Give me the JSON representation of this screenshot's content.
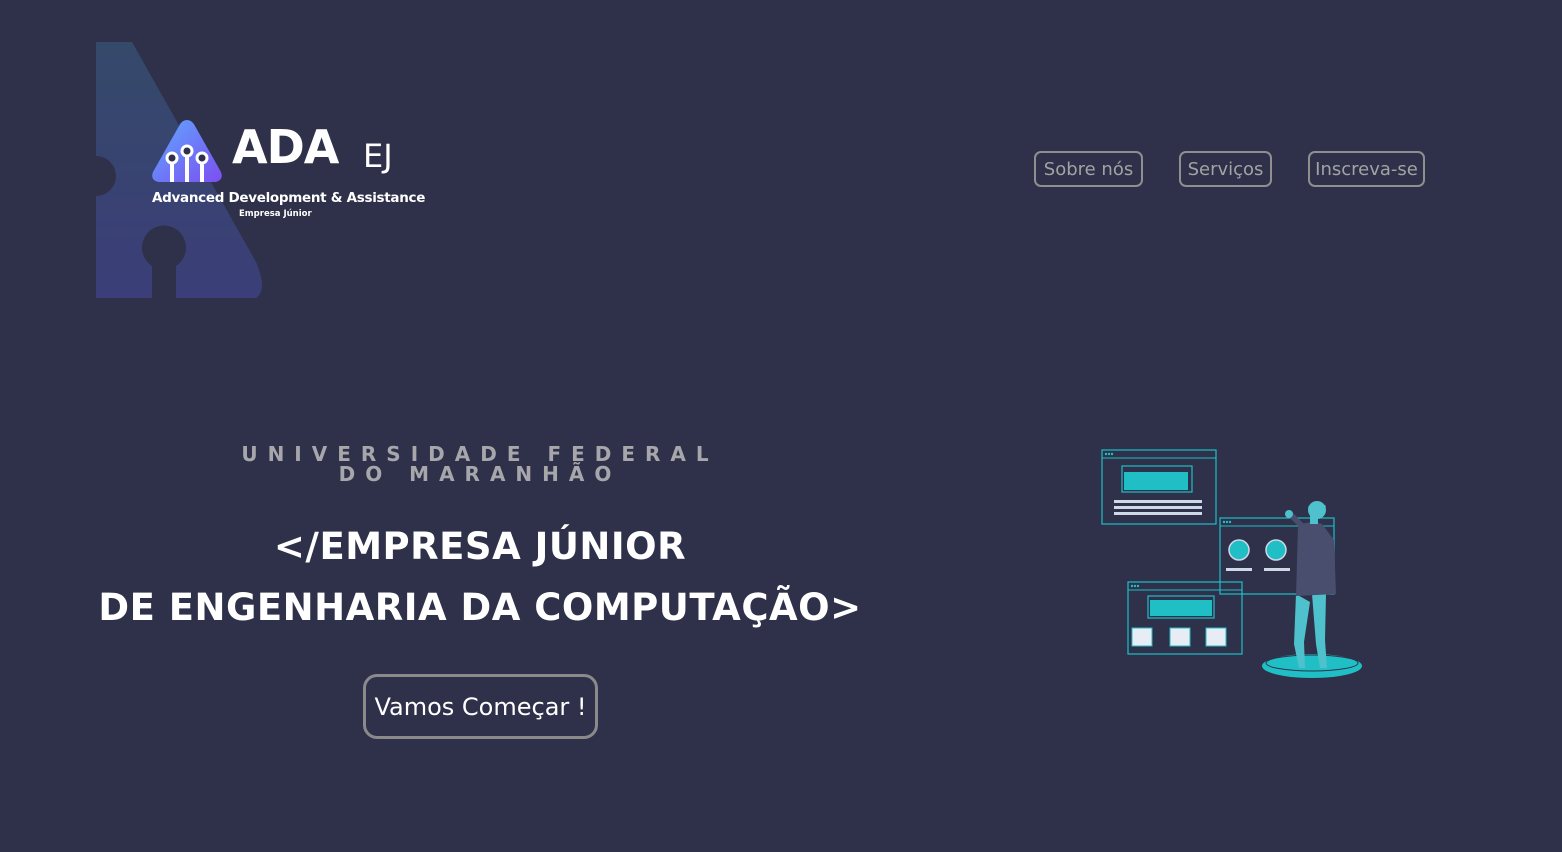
{
  "brand": {
    "name": "ADA",
    "suffix": "EJ",
    "tagline": "Advanced Development & Assistance",
    "subtitle": "Empresa Júnior"
  },
  "nav": {
    "items": [
      {
        "label": "Sobre nós"
      },
      {
        "label": "Serviços"
      },
      {
        "label": "Inscreva-se"
      }
    ]
  },
  "hero": {
    "kicker": "UNIVERSIDADE FEDERAL DO MARANHÃO",
    "title_line1": "</EMPRESA JÚNIOR",
    "title_line2": "DE ENGENHARIA DA COMPUTAÇÃO>",
    "cta_label": "Vamos Começar !"
  },
  "colors": {
    "background": "#2e3149",
    "accent": "#1fbfc5",
    "logo_gradient_top": "#5c7cfa",
    "logo_gradient_bottom": "#6b4fe8",
    "button_border": "#8f8f8f"
  },
  "icons": {
    "logo": "ada-logo-icon",
    "illustration": "person-with-screens-illustration"
  }
}
